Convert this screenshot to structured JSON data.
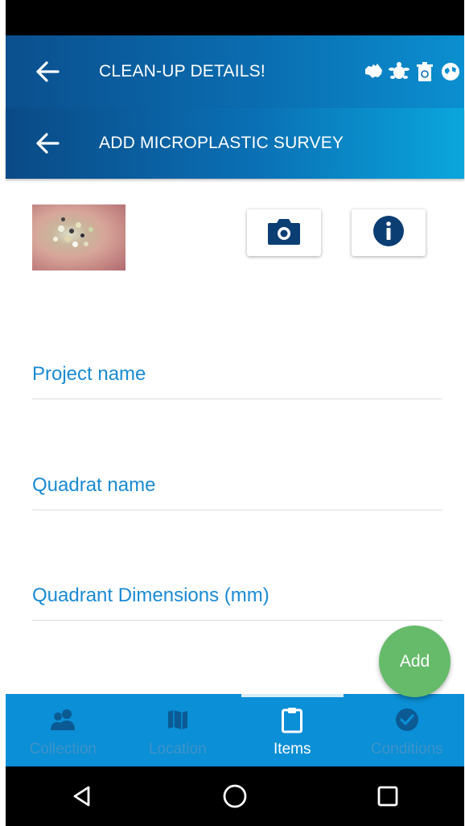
{
  "header": {
    "title": "CLEAN-UP DETAILS!",
    "logos": [
      "australia-logo-icon",
      "turtle-logo-icon",
      "recycle-bin-logo-icon",
      "globe-logo-icon"
    ]
  },
  "subheader": {
    "title": "ADD MICROPLASTIC SURVEY"
  },
  "form": {
    "fields": [
      {
        "label": "Project name"
      },
      {
        "label": "Quadrat name"
      },
      {
        "label": "Quadrant Dimensions (mm)"
      }
    ]
  },
  "fab": {
    "label": "Add",
    "color": "#66bb6a"
  },
  "bottom_nav": {
    "items": [
      {
        "label": "Collection",
        "icon": "people-icon",
        "active": false
      },
      {
        "label": "Location",
        "icon": "map-icon",
        "active": false
      },
      {
        "label": "Items",
        "icon": "clipboard-icon",
        "active": true
      },
      {
        "label": "Conditions",
        "icon": "check-circle-icon",
        "active": false
      }
    ]
  },
  "colors": {
    "primary": "#0b5fa5",
    "field_label": "#1a8ad4",
    "icon_dark": "#0b3e73",
    "nav_bg": "#0b8fd6"
  }
}
